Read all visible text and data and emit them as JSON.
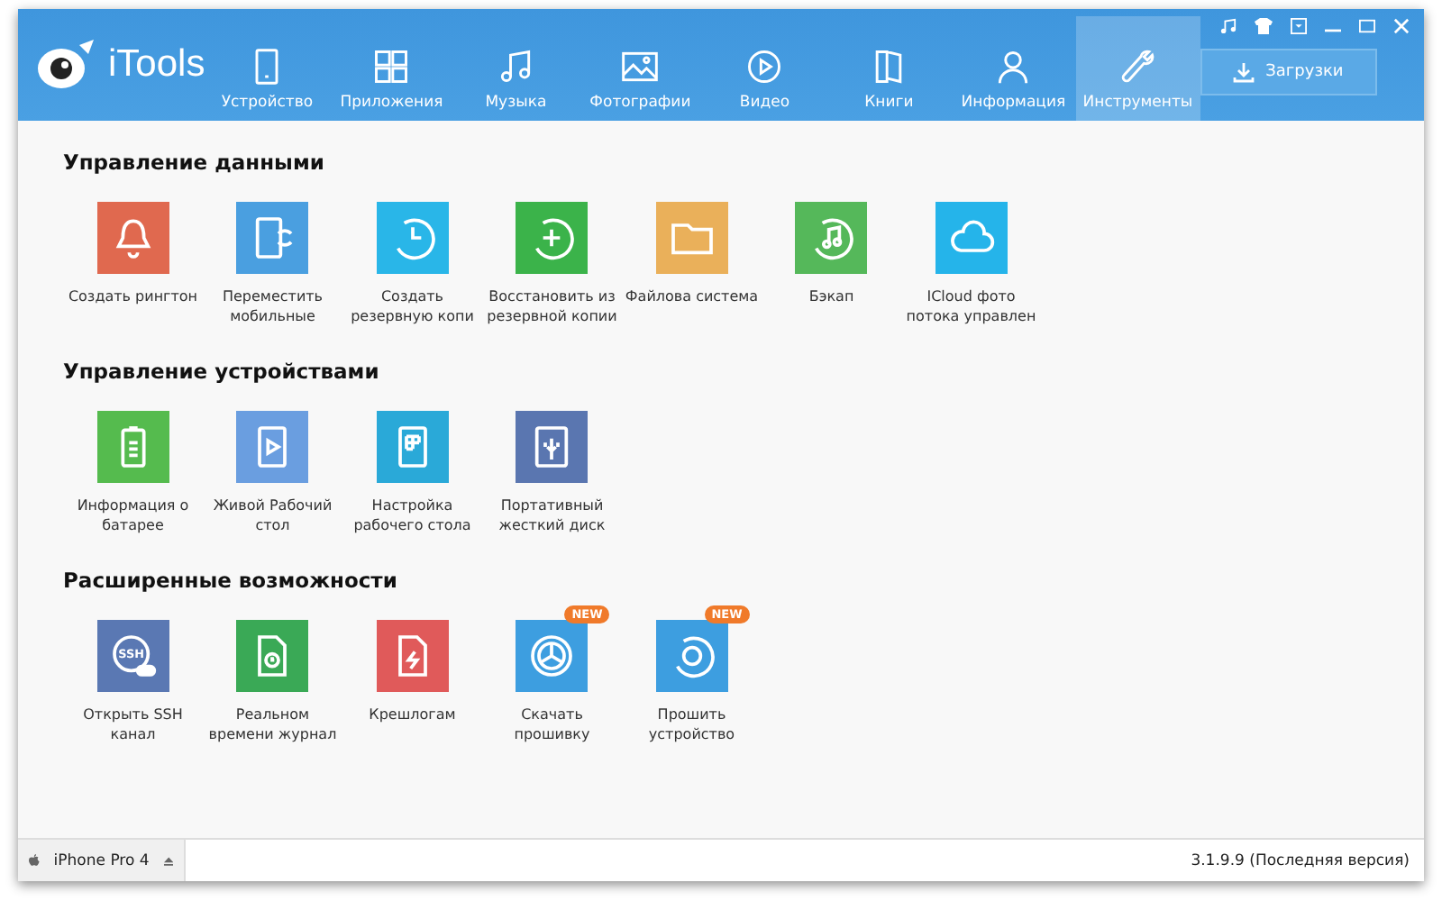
{
  "app": {
    "name": "iTools"
  },
  "tabs": [
    {
      "label": "Устройство",
      "selected": false
    },
    {
      "label": "Приложения",
      "selected": false
    },
    {
      "label": "Музыка",
      "selected": false
    },
    {
      "label": "Фотографии",
      "selected": false
    },
    {
      "label": "Видео",
      "selected": false
    },
    {
      "label": "Книги",
      "selected": false
    },
    {
      "label": "Информация",
      "selected": false
    },
    {
      "label": "Инструменты",
      "selected": true
    }
  ],
  "download_button": "Загрузки",
  "sections": [
    {
      "title": "Управление данными",
      "tools": [
        {
          "label": "Создать рингтон",
          "color": "#e0694f"
        },
        {
          "label": "Переместить мобильные",
          "color": "#4a9fe0"
        },
        {
          "label": "Создать резервную копи",
          "color": "#29b6e8"
        },
        {
          "label": "Восстановить из резервной копии",
          "color": "#3bb34a"
        },
        {
          "label": "Файлова система",
          "color": "#eab05a"
        },
        {
          "label": "Бэкап",
          "color": "#55b85a"
        },
        {
          "label": "ICloud фото потока управлен",
          "color": "#25b4ea"
        }
      ]
    },
    {
      "title": "Управление устройствами",
      "tools": [
        {
          "label": "Информация о батарее",
          "color": "#55bb4e"
        },
        {
          "label": "Живой Рабочий стол",
          "color": "#6a9ee0"
        },
        {
          "label": "Настройка рабочего стола",
          "color": "#2aa9d8"
        },
        {
          "label": "Портативный жесткий диск",
          "color": "#5a76b0"
        }
      ]
    },
    {
      "title": "Расширенные возможности",
      "tools": [
        {
          "label": "Открыть SSH канал",
          "color": "#5a78b3",
          "icon_text": "SSH"
        },
        {
          "label": "Реальном времени журнал",
          "color": "#3aa956"
        },
        {
          "label": "Крешлогам",
          "color": "#e05a5a"
        },
        {
          "label": "Скачать прошивку",
          "color": "#3d9ee0",
          "badge": "NEW"
        },
        {
          "label": "Прошить устройство",
          "color": "#3d9ee0",
          "badge": "NEW"
        }
      ]
    }
  ],
  "status_bar": {
    "device": "iPhone Pro 4",
    "version": "3.1.9.9 (Последняя версия)"
  }
}
